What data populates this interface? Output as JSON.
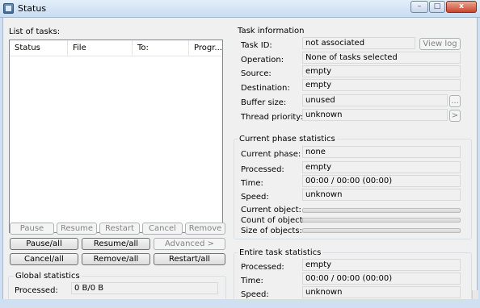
{
  "window": {
    "title": "Status",
    "minimize": "–",
    "maximize": "□",
    "close": "x"
  },
  "tasks": {
    "list_label": "List of tasks:",
    "columns": [
      "Status",
      "File",
      "To:",
      "Progr..."
    ]
  },
  "task_buttons": {
    "pause": "Pause",
    "resume": "Resume",
    "restart": "Restart",
    "cancel": "Cancel",
    "remove": "Remove",
    "pause_all": "Pause/all",
    "resume_all": "Resume/all",
    "advanced": "Advanced >",
    "cancel_all": "Cancel/all",
    "remove_all": "Remove/all",
    "restart_all": "Restart/all"
  },
  "global_stats": {
    "title": "Global statistics",
    "processed_label": "Processed:",
    "processed_value": "0 B/0 B"
  },
  "task_info": {
    "title": "Task information",
    "task_id_label": "Task ID:",
    "task_id_value": "not associated",
    "view_log": "View log",
    "operation_label": "Operation:",
    "operation_value": "None of tasks selected",
    "source_label": "Source:",
    "source_value": "empty",
    "destination_label": "Destination:",
    "destination_value": "empty",
    "buffer_label": "Buffer size:",
    "buffer_value": "unused",
    "buffer_button": "...",
    "thread_label": "Thread priority:",
    "thread_value": "unknown",
    "thread_button": ">"
  },
  "phase_stats": {
    "title": "Current phase statistics",
    "phase_label": "Current phase:",
    "phase_value": "none",
    "processed_label": "Processed:",
    "processed_value": "empty",
    "time_label": "Time:",
    "time_value": "00:00 / 00:00 (00:00)",
    "speed_label": "Speed:",
    "speed_value": "unknown",
    "object_label": "Current object:",
    "count_label": "Count of objects:",
    "size_label": "Size of objects:"
  },
  "entire_stats": {
    "title": "Entire task statistics",
    "processed_label": "Processed:",
    "processed_value": "empty",
    "time_label": "Time:",
    "time_value": "00:00 / 00:00 (00:00)",
    "speed_label": "Speed:",
    "speed_value": "unknown"
  }
}
